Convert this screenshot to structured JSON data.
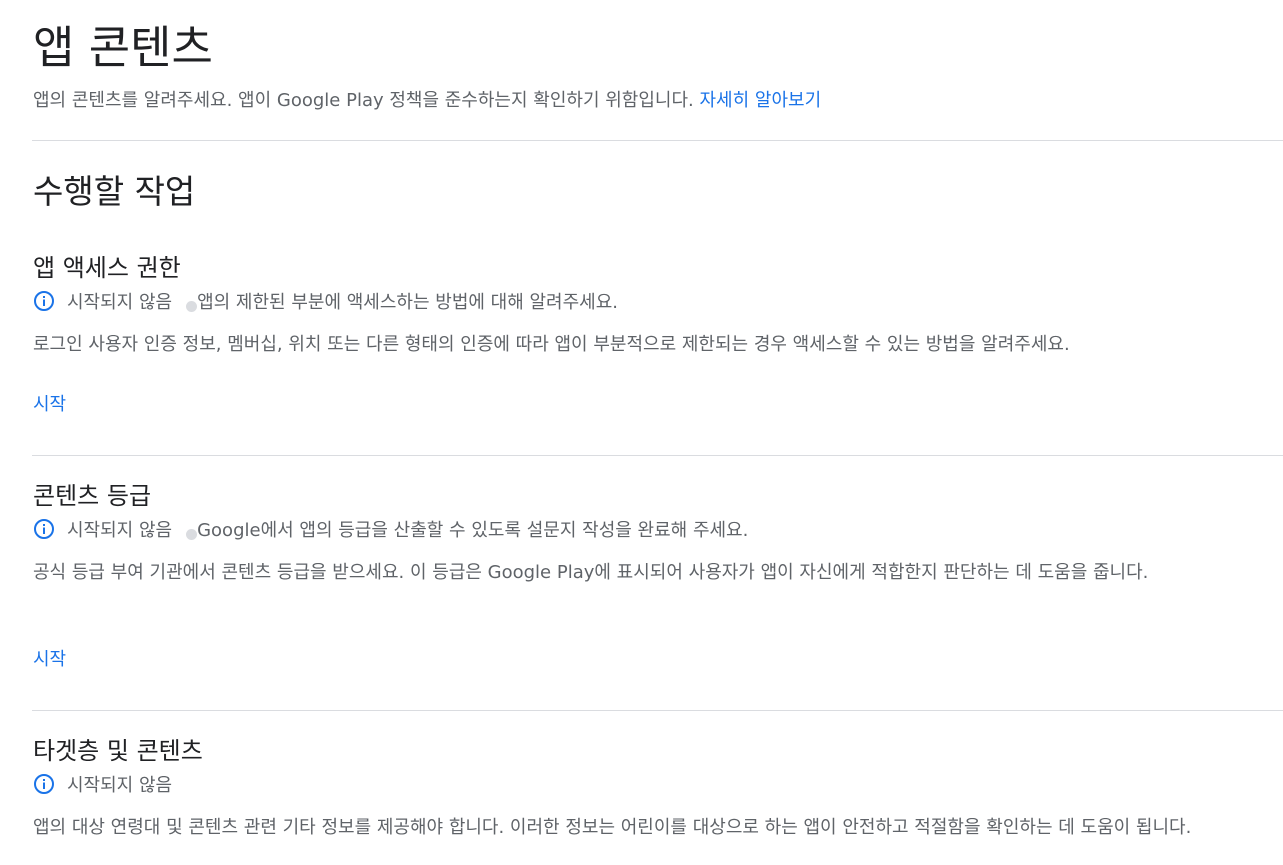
{
  "header": {
    "title": "앱 콘텐츠",
    "description": "앱의 콘텐츠를 알려주세요. 앱이 Google Play 정책을 준수하는지 확인하기 위함입니다.",
    "learn_more": "자세히 알아보기"
  },
  "section": {
    "title": "수행할 작업"
  },
  "tasks": [
    {
      "title": "앱 액세스 권한",
      "status": "시작되지 않음",
      "status_desc": "앱의 제한된 부분에 액세스하는 방법에 대해 알려주세요.",
      "description": "로그인 사용자 인증 정보, 멤버십, 위치 또는 다른 형태의 인증에 따라 앱이 부분적으로 제한되는 경우 액세스할 수 있는 방법을 알려주세요.",
      "action": "시작"
    },
    {
      "title": "콘텐츠 등급",
      "status": "시작되지 않음",
      "status_desc": "Google에서 앱의 등급을 산출할 수 있도록 설문지 작성을 완료해 주세요.",
      "description": "공식 등급 부여 기관에서 콘텐츠 등급을 받으세요. 이 등급은 Google Play에 표시되어 사용자가 앱이 자신에게 적합한지 판단하는 데 도움을 줍니다.",
      "action": "시작"
    },
    {
      "title": "타겟층 및 콘텐츠",
      "status": "시작되지 않음",
      "description": "앱의 대상 연령대 및 콘텐츠 관련 기타 정보를 제공해야 합니다. 이러한 정보는 어린이를 대상으로 하는 앱이 안전하고 적절함을 확인하는 데 도움이 됩니다."
    }
  ],
  "icons": {
    "status": "info-icon",
    "status_color": "#1a73e8",
    "dot_color": "#dadce0"
  }
}
